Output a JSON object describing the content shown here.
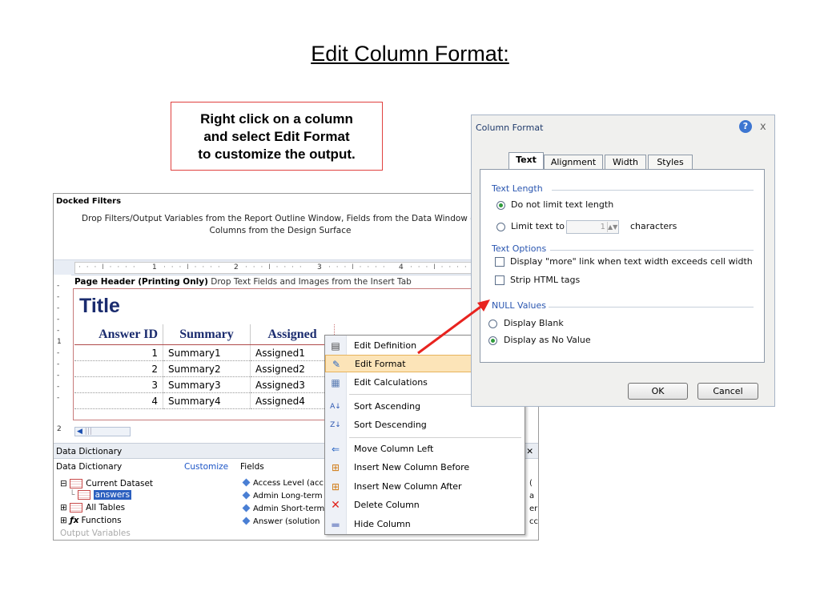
{
  "slide": {
    "title": "Edit Column Format:",
    "callout": "Right click on a column\nand select Edit Format\nto customize the output."
  },
  "designer": {
    "docked_filters_title": "Docked Filters",
    "docked_filters_desc": "Drop Filters/Output Variables from the Report Outline Window, Fields from the Data Window or Columns from the Design Surface",
    "ruler_marks": [
      "1",
      "2",
      "3",
      "4"
    ],
    "page_header_label": "Page Header (Printing Only)",
    "page_header_desc": "Drop Text Fields and Images from the Insert Tab",
    "report_title": "Title",
    "columns": [
      "Answer ID",
      "Summary",
      "Assigned"
    ],
    "rows": [
      [
        "1",
        "Summary1",
        "Assigned1"
      ],
      [
        "2",
        "Summary2",
        "Assigned2"
      ],
      [
        "3",
        "Summary3",
        "Assigned3"
      ],
      [
        "4",
        "Summary4",
        "Assigned4"
      ]
    ],
    "gutter_marks": [
      "-",
      "-",
      "-",
      "-",
      "-",
      "1",
      "-",
      "-",
      "-",
      "-",
      "-",
      "2"
    ]
  },
  "data_dictionary": {
    "header": "Data Dictionary",
    "left_title": "Data Dictionary",
    "customize": "Customize",
    "fields_title": "Fields",
    "tree": [
      {
        "label": "Current Dataset",
        "expander": "⊟"
      },
      {
        "label": "answers",
        "expander": "└"
      },
      {
        "label": "All Tables",
        "expander": "⊞"
      },
      {
        "label": "Functions",
        "expander": "⊞"
      },
      {
        "label": "Output Variables",
        "expander": ""
      }
    ],
    "fields": [
      "Access Level (acc",
      "Admin Long-term",
      "Admin Short-term",
      "Answer (solution"
    ],
    "right_clip": [
      "(",
      "a",
      "er",
      "cc"
    ]
  },
  "context_menu": {
    "items": [
      {
        "label": "Edit Definition",
        "icon": "edit-definition-icon",
        "glyph": "▤"
      },
      {
        "label": "Edit Format",
        "icon": "edit-format-icon",
        "glyph": "✎"
      },
      {
        "label": "Edit Calculations",
        "icon": "calculator-icon",
        "glyph": "▦"
      },
      {
        "label": "Sort Ascending",
        "icon": "sort-ascending-icon",
        "glyph": "A↓"
      },
      {
        "label": "Sort Descending",
        "icon": "sort-descending-icon",
        "glyph": "Z↓"
      },
      {
        "label": "Move Column Left",
        "icon": "arrow-left-icon",
        "glyph": "⇐"
      },
      {
        "label": "Insert New Column Before",
        "icon": "insert-before-icon",
        "glyph": "⊞"
      },
      {
        "label": "Insert New Column After",
        "icon": "insert-after-icon",
        "glyph": "⊞"
      },
      {
        "label": "Delete Column",
        "icon": "delete-x-icon",
        "glyph": "✕"
      },
      {
        "label": "Hide Column",
        "icon": "hide-column-icon",
        "glyph": "▬"
      }
    ],
    "highlighted": "Edit Format"
  },
  "dialog": {
    "title": "Column Format",
    "help_glyph": "?",
    "close_glyph": "x",
    "tabs": [
      "Text",
      "Alignment",
      "Width",
      "Styles"
    ],
    "active_tab": "Text",
    "text_length_group": "Text Length",
    "do_not_limit": "Do not limit text length",
    "limit_text_to": "Limit text to",
    "limit_value": "1",
    "characters": "characters",
    "text_options_group": "Text Options",
    "display_more": "Display \"more\" link when text width exceeds cell width",
    "strip_html": "Strip HTML tags",
    "null_values_group": "NULL Values",
    "display_blank": "Display Blank",
    "display_no_value": "Display as No Value",
    "ok": "OK",
    "cancel": "Cancel"
  },
  "colors": {
    "arrow": "#e8231f",
    "title_navy": "#1a2b6e",
    "menu_highlight": "#fce4b8"
  }
}
